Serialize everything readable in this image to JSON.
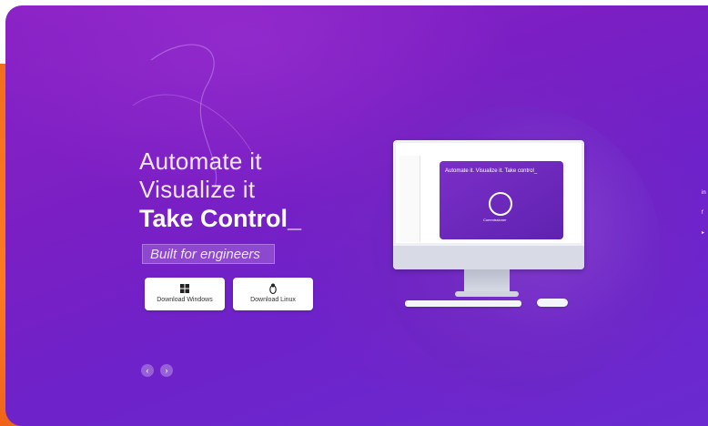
{
  "hero": {
    "line1": "Automate it",
    "line2": "Visualize it",
    "line3": "Take Control_",
    "badge": "Built for engineers",
    "download_windows": "Download Windows",
    "download_linux": "Download Linux"
  },
  "carousel": {
    "prev": "‹",
    "next": "›"
  },
  "social": [
    {
      "name": "linkedin-icon",
      "glyph": "in"
    },
    {
      "name": "facebook-icon",
      "glyph": "f"
    },
    {
      "name": "youtube-icon",
      "glyph": "▸"
    }
  ],
  "monitor_screen": {
    "title": "Automate it. Visualize it. Take control_",
    "brand": "Commissioner"
  },
  "colors": {
    "hero_purple": "#7a1fc4",
    "accent_orange": "#f0701a"
  }
}
